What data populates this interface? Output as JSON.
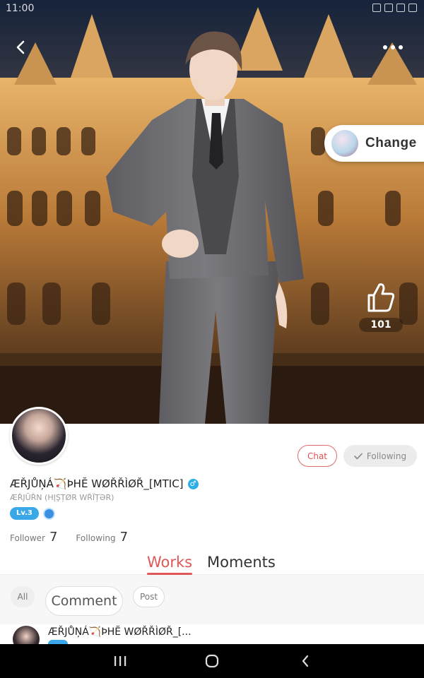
{
  "status_bar": {
    "time": "11:00"
  },
  "hero": {
    "change_label": "Change",
    "like_count": "101"
  },
  "profile": {
    "username": "ÆŘJŮŅÁ🏹ÞHĔ WØŘŘÌØŘ_[MTIC]",
    "gender_symbol": "♂",
    "subtitle": "ÆŘJŨŘN (HĮŞȚØR WŘÏȚƏR)",
    "level": "Lv.3",
    "follower_label": "Follower",
    "follower_count": "7",
    "following_label": "Following",
    "following_count": "7",
    "chat_label": "Chat",
    "following_button_label": "Following"
  },
  "tabs": {
    "works": "Works",
    "moments": "Moments"
  },
  "filters": {
    "all": "All",
    "comment": "Comment",
    "post": "Post"
  },
  "post": {
    "author": "ÆŘJŮŅÁ🏹ÞHĔ WØŘŘÌØŘ_[..."
  },
  "colors": {
    "accent": "#e15656",
    "level_blue": "#3aa8e8",
    "nav_bg": "#000000"
  },
  "icons": [
    "back-arrow-icon",
    "more-dots-icon",
    "thumbs-up-icon",
    "check-icon",
    "male-icon",
    "recents-icon",
    "home-icon",
    "nav-back-icon"
  ]
}
